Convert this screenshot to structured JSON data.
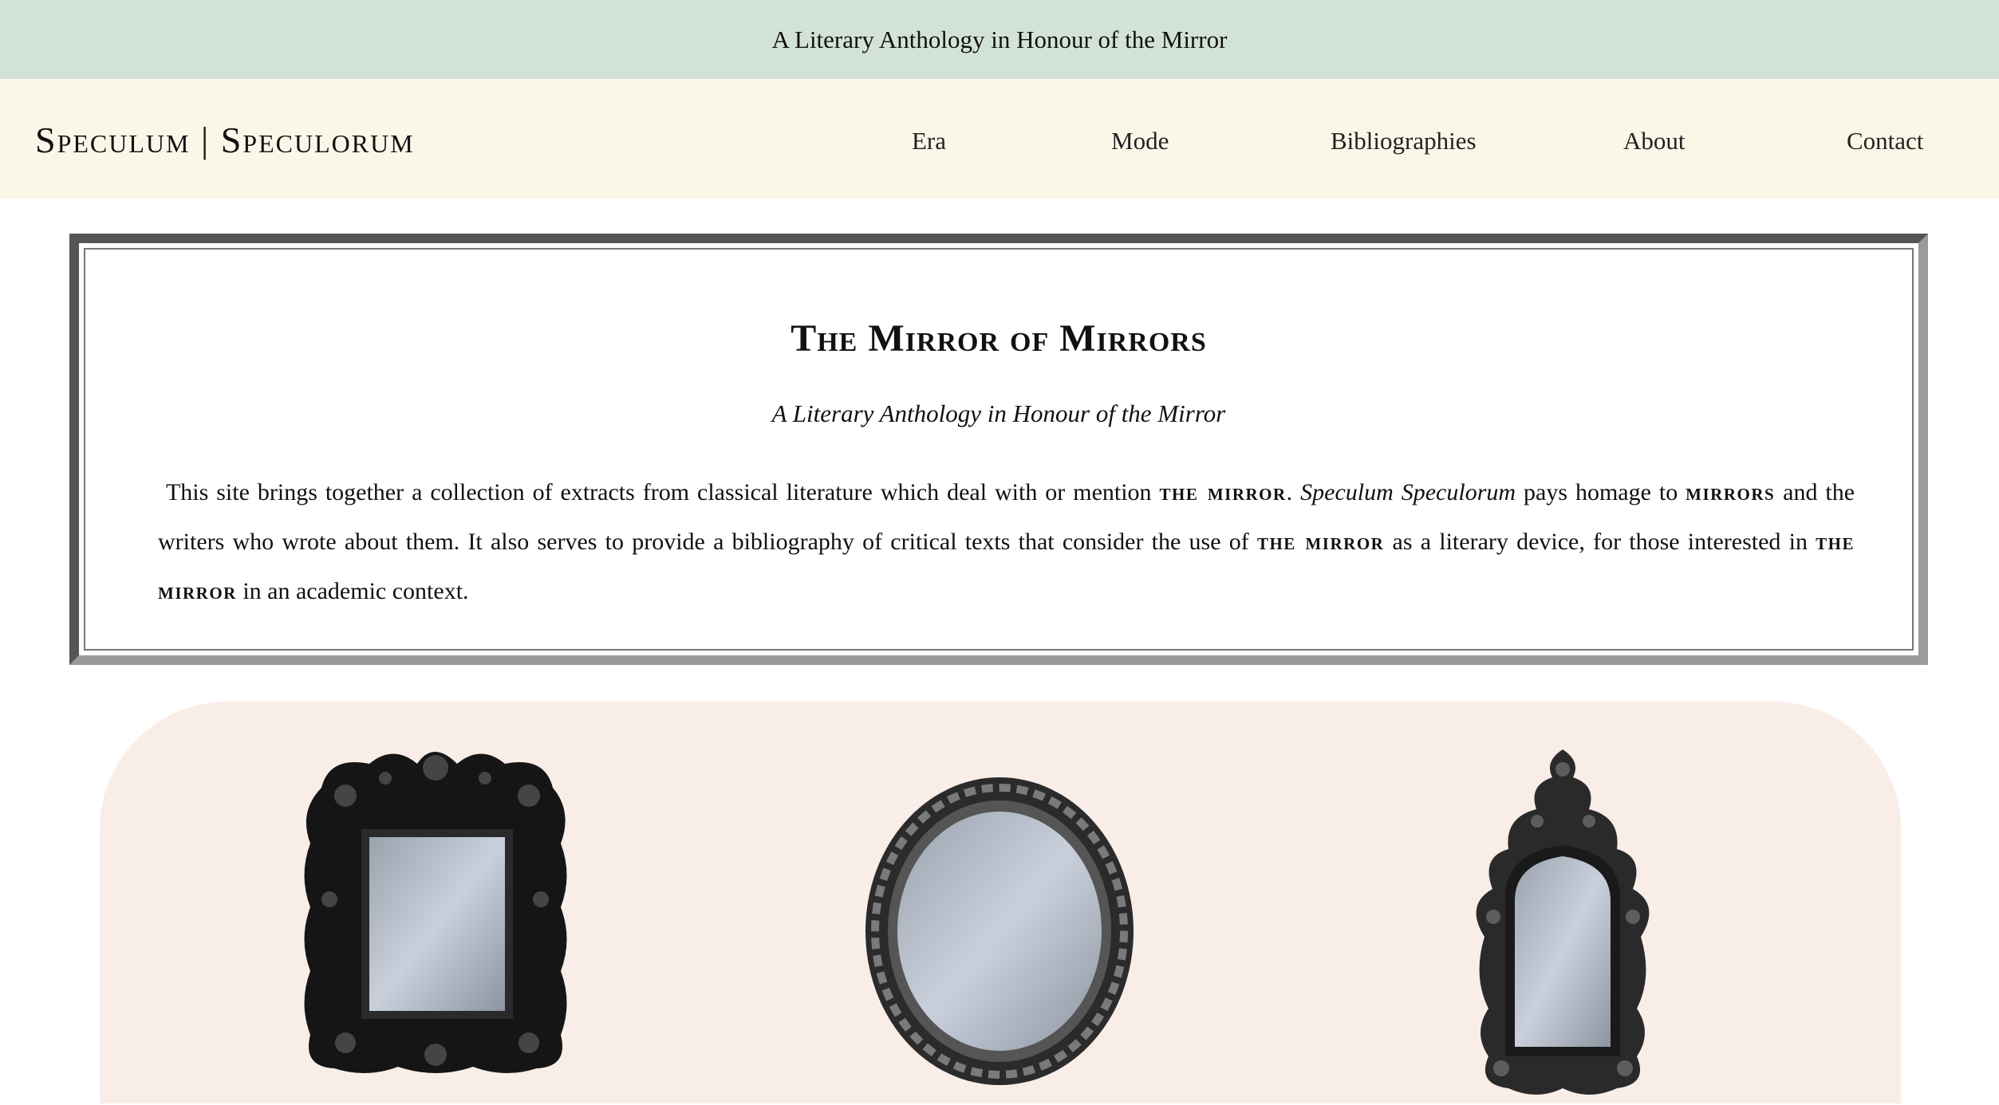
{
  "banner": {
    "text": "A Literary Anthology in Honour of the Mirror"
  },
  "header": {
    "logo": "Speculum | Speculorum",
    "nav": [
      {
        "label": "Era"
      },
      {
        "label": "Mode"
      },
      {
        "label": "Bibliographies"
      },
      {
        "label": "About"
      },
      {
        "label": "Contact"
      }
    ]
  },
  "intro": {
    "title": "The Mirror of Mirrors",
    "subtitle": "A Literary Anthology in Honour of the Mirror",
    "p1": "This site brings together a collection of extracts from classical literature which deal with or mention",
    "mirror1": "the mirror",
    "p2": ".",
    "site_name": "Speculum Speculorum",
    "p3": "pays homage to",
    "mirrors": "mirrors",
    "p4": "and the writers who wrote about them. It also serves to provide a bibliography of critical texts that consider the use of",
    "mirror2": "the mirror",
    "p5": "as a literary device, for those interested in",
    "mirror3": "the mirror",
    "p6": "in an academic context."
  },
  "gallery": {
    "items": [
      {
        "icon": "ornate-rectangular-mirror-icon"
      },
      {
        "icon": "oval-mirror-icon"
      },
      {
        "icon": "rococo-arched-mirror-icon"
      }
    ]
  },
  "colors": {
    "banner_bg": "#d3e2d6",
    "nav_bg": "#faf7e8",
    "gallery_bg": "#f9ede8",
    "frame_dark": "#1a1a1a",
    "glass": "#c5cdd8"
  }
}
